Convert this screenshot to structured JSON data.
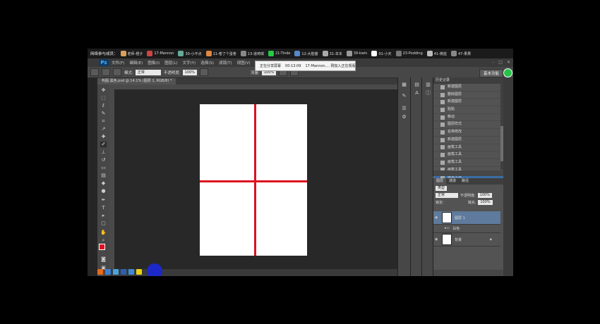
{
  "participants_bar": {
    "label": "网络参与成员：",
    "items": [
      {
        "name": "老师-橙子",
        "color": "#d9a05b"
      },
      {
        "name": "17-Mannon",
        "color": "#c44"
      },
      {
        "name": "30-小不点",
        "color": "#6a9"
      },
      {
        "name": "11-卷了个蛋卷",
        "color": "#d84"
      },
      {
        "name": "13-道琦琪",
        "color": "#888"
      },
      {
        "name": "21-Tinde",
        "color": "#2c4"
      },
      {
        "name": "12-大脸猫",
        "color": "#58c"
      },
      {
        "name": "31-本本",
        "color": "#aaa"
      },
      {
        "name": "39-kwin",
        "color": "#999"
      },
      {
        "name": "01-小天",
        "color": "#fff"
      },
      {
        "name": "23-Podding",
        "color": "#777"
      },
      {
        "name": "41-微蓝",
        "color": "#bbb"
      },
      {
        "name": "47-果果",
        "color": "#888"
      }
    ]
  },
  "menubar": {
    "logo": "Ps",
    "items": [
      "文件(F)",
      "编辑(E)",
      "图像(I)",
      "图层(L)",
      "文字(Y)",
      "选择(S)",
      "滤镜(T)",
      "视图(V)"
    ]
  },
  "options": {
    "mode_label": "模式:",
    "mode_value": "正常",
    "opacity_label": "不透明度:",
    "opacity_value": "100%",
    "flow_label": "流量:",
    "flow_value": "100%",
    "workspace": "基本功能"
  },
  "share_notice": {
    "status": "正在分享屏幕",
    "time": "00:13:09",
    "message": "17-Mannon.... 刚加入正在观看"
  },
  "document": {
    "tab_label": "构图.黑色.psd @ 14.1% (图层 1, RGB/8) *",
    "line_color": "#dc1020"
  },
  "history": {
    "tab": "历史记录",
    "items": [
      {
        "label": "新建图层",
        "icon": "layer-icon"
      },
      {
        "label": "删除图层",
        "icon": "layer-icon"
      },
      {
        "label": "新建图层",
        "icon": "layer-icon"
      },
      {
        "label": "贴贴",
        "icon": "layer-icon"
      },
      {
        "label": "移动",
        "icon": "move-icon"
      },
      {
        "label": "图层样式",
        "icon": "layer-icon"
      },
      {
        "label": "名称修改",
        "icon": "layer-icon"
      },
      {
        "label": "新建图层",
        "icon": "layer-icon"
      },
      {
        "label": "画笔工具",
        "icon": "brush-icon"
      },
      {
        "label": "画笔工具",
        "icon": "brush-icon"
      },
      {
        "label": "画笔工具",
        "icon": "brush-icon"
      },
      {
        "label": "画笔工具",
        "icon": "brush-icon"
      },
      {
        "label": "画笔工具",
        "icon": "brush-icon"
      }
    ]
  },
  "layers": {
    "tabs": [
      "图层",
      "通道",
      "路径"
    ],
    "kind_label": "类型",
    "blend_value": "正常",
    "opacity_label": "不透明度:",
    "opacity_value": "100%",
    "lock_label": "锁定:",
    "fill_label": "填充:",
    "fill_value": "100%",
    "items": [
      {
        "name": "图层 1"
      },
      {
        "name": "白色"
      },
      {
        "name": "背景"
      }
    ]
  },
  "colors": {
    "foreground": "#e01020",
    "background": "#ffffff"
  }
}
